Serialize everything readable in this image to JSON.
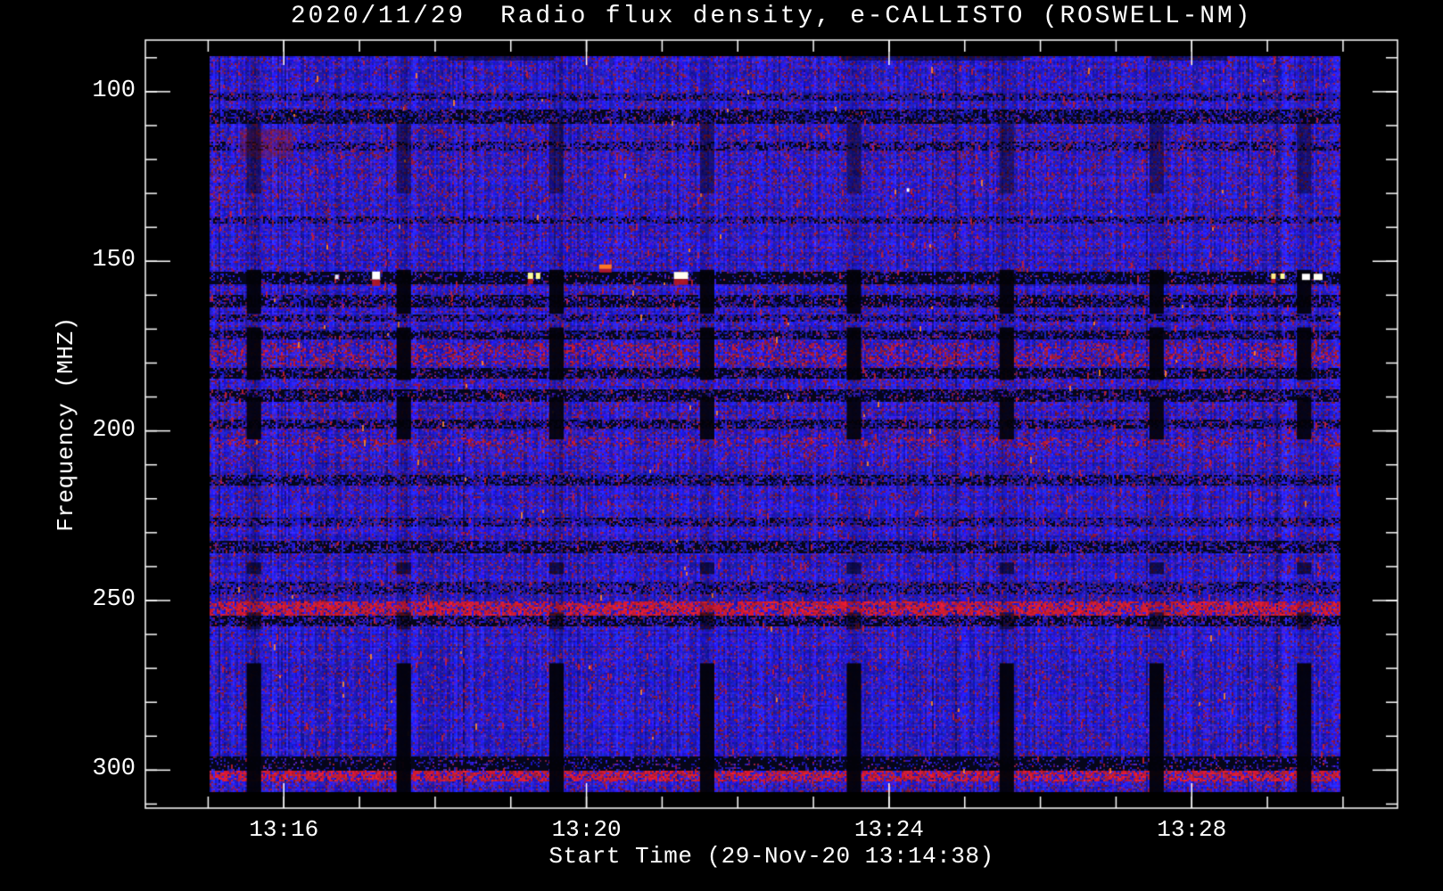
{
  "window": {
    "background": "#000000",
    "foreground": "#ffffff"
  },
  "chart_data": {
    "type": "heatmap",
    "subtype": "solar-radio-spectrogram",
    "title": "2020/11/29  Radio flux density, e-CALLISTO (ROSWELL-NM)",
    "xlabel": "Start Time (29-Nov-20 13:14:38)",
    "ylabel": "Frequency (MHZ)",
    "legend": "none",
    "grid": "off",
    "axis_color": "#ffffff",
    "x_axis": {
      "start_time_label": "13:14:38",
      "major_tick_labels": [
        "13:16",
        "13:20",
        "13:24",
        "13:28"
      ],
      "major_tick_t": [
        1.83,
        5.83,
        9.83,
        13.83
      ],
      "minor_tick_first_t": 0.83,
      "minor_tick_step_min": 1,
      "t_range": [
        0,
        16.55
      ],
      "data_t_range": [
        0.85,
        15.79
      ]
    },
    "y_axis": {
      "unit": "MHZ",
      "major_ticks": [
        100,
        150,
        200,
        250,
        300
      ],
      "minor_step": 10,
      "f_range": [
        84.8,
        311.2
      ],
      "data_f_range": [
        89.5,
        306.5
      ],
      "direction": "inverted (low freq at top)"
    },
    "palette": {
      "background": "#000000",
      "base_blue_low": [
        18,
        14,
        168
      ],
      "base_blue_high": [
        55,
        45,
        255
      ],
      "maroon": "#8c1a33",
      "purple": "#5a2aa0",
      "bright_red": "#cd1e2d",
      "orange_fleck": "#ff8c28",
      "near_black": "#06061a",
      "spot_white": "#ffffff"
    },
    "zones": [
      {
        "f": [
          89.5,
          110
        ],
        "p": 0.2
      },
      {
        "f": [
          110,
          130
        ],
        "p": 0.3
      },
      {
        "f": [
          130,
          152
        ],
        "p": 0.24
      },
      {
        "f": [
          156,
          174
        ],
        "p": 0.26
      },
      {
        "f": [
          174,
          210
        ],
        "p": 0.3
      },
      {
        "f": [
          210,
          244
        ],
        "p": 0.22
      },
      {
        "f": [
          244,
          258
        ],
        "p": 0.26
      },
      {
        "f": [
          258,
          296
        ],
        "p": 0.18
      },
      {
        "f": [
          296,
          306.5
        ],
        "p": 0.3
      }
    ],
    "bands": [
      {
        "f": [
          100.3,
          102.6
        ],
        "kind": "dark",
        "p": 0.28
      },
      {
        "f": [
          104.8,
          109.2
        ],
        "kind": "dark",
        "p": 0.5
      },
      {
        "f": [
          114.5,
          117.2
        ],
        "kind": "dark",
        "p": 0.3
      },
      {
        "f": [
          136.4,
          138.6
        ],
        "kind": "dark",
        "p": 0.3
      },
      {
        "f": [
          152.8,
          156.3
        ],
        "kind": "dark",
        "p": 0.72
      },
      {
        "f": [
          159.8,
          163.2
        ],
        "kind": "dark",
        "p": 0.5
      },
      {
        "f": [
          165.5,
          167.6
        ],
        "kind": "dark",
        "p": 0.3
      },
      {
        "f": [
          169.9,
          172.9
        ],
        "kind": "dark",
        "p": 0.5
      },
      {
        "f": [
          174.0,
          180.6
        ],
        "kind": "reddots",
        "p": 0.22
      },
      {
        "f": [
          181.3,
          184.1
        ],
        "kind": "dark",
        "p": 0.55
      },
      {
        "f": [
          187.6,
          191.1
        ],
        "kind": "dark",
        "p": 0.55
      },
      {
        "f": [
          196.2,
          199.1
        ],
        "kind": "dark",
        "p": 0.45
      },
      {
        "f": [
          201.5,
          204.2
        ],
        "kind": "reddots",
        "p": 0.2
      },
      {
        "f": [
          212.8,
          215.6
        ],
        "kind": "dark",
        "p": 0.4
      },
      {
        "f": [
          225.1,
          227.9
        ],
        "kind": "dark",
        "p": 0.26
      },
      {
        "f": [
          232.2,
          235.8
        ],
        "kind": "dark",
        "p": 0.5
      },
      {
        "f": [
          244.3,
          248.1
        ],
        "kind": "dark",
        "p": 0.26
      },
      {
        "f": [
          250.0,
          254.3
        ],
        "kind": "red",
        "p": 0.66
      },
      {
        "f": [
          254.3,
          257.6
        ],
        "kind": "dark",
        "p": 0.5
      },
      {
        "f": [
          295.9,
          299.9
        ],
        "kind": "dark",
        "p": 0.75
      },
      {
        "f": [
          299.9,
          303.3
        ],
        "kind": "red",
        "p": 0.6
      }
    ],
    "clouds": [
      {
        "t": [
          1.25,
          1.95
        ],
        "f": [
          111,
          119.5
        ],
        "color": "rgba(140,25,45,0.38)"
      }
    ],
    "gaps": {
      "t_positions": [
        1.34,
        3.32,
        5.34,
        7.33,
        9.27,
        11.29,
        13.27,
        15.22
      ],
      "width_t": 0.19,
      "column_alpha": 0.14,
      "segments": [
        {
          "f": [
            109,
            130
          ],
          "a": 0.38
        },
        {
          "f": [
            152.5,
            165.5
          ],
          "a": 0.93
        },
        {
          "f": [
            169.5,
            185
          ],
          "a": 0.93
        },
        {
          "f": [
            190,
            202.5
          ],
          "a": 0.9
        },
        {
          "f": [
            238.8,
            242.2
          ],
          "a": 0.6
        },
        {
          "f": [
            253.5,
            258.5
          ],
          "a": 0.55
        },
        {
          "f": [
            268.5,
            306.5
          ],
          "a": 0.95
        }
      ]
    },
    "top_dark_patches": [
      {
        "t": [
          4.0,
          5.4
        ]
      },
      {
        "t": [
          9.2,
          11.6
        ]
      },
      {
        "t": [
          13.3,
          14.3
        ]
      }
    ],
    "spots": [
      {
        "t": 2.53,
        "f": 154.6,
        "w": 4,
        "h": 5,
        "c": "#e8e8ff",
        "red_below": false
      },
      {
        "t": 3.05,
        "f": 154.2,
        "w": 9,
        "h": 9,
        "c": "#ffffff",
        "red_below": true
      },
      {
        "t": 5.09,
        "f": 154.3,
        "w": 6,
        "h": 7,
        "c": "#ffff99",
        "red_below": true
      },
      {
        "t": 5.19,
        "f": 154.3,
        "w": 5,
        "h": 7,
        "c": "#ffff99",
        "red_below": false
      },
      {
        "t": 6.08,
        "f": 151.6,
        "w": 14,
        "h": 5,
        "c": "#ff7722",
        "red_below": true
      },
      {
        "t": 7.08,
        "f": 154.2,
        "w": 16,
        "h": 8,
        "c": "#fffff0",
        "red_below": true
      },
      {
        "t": 10.08,
        "f": 129.0,
        "w": 3,
        "h": 4,
        "c": "#ffffff",
        "red_below": false
      },
      {
        "t": 14.91,
        "f": 154.4,
        "w": 5,
        "h": 6,
        "c": "#ffee88",
        "red_below": true
      },
      {
        "t": 15.03,
        "f": 154.4,
        "w": 5,
        "h": 6,
        "c": "#ffff99",
        "red_below": false
      },
      {
        "t": 15.34,
        "f": 154.6,
        "w": 9,
        "h": 7,
        "c": "#ffffff",
        "red_below": false
      },
      {
        "t": 15.5,
        "f": 154.6,
        "w": 10,
        "h": 7,
        "c": "#fffff0",
        "red_below": false
      }
    ]
  }
}
